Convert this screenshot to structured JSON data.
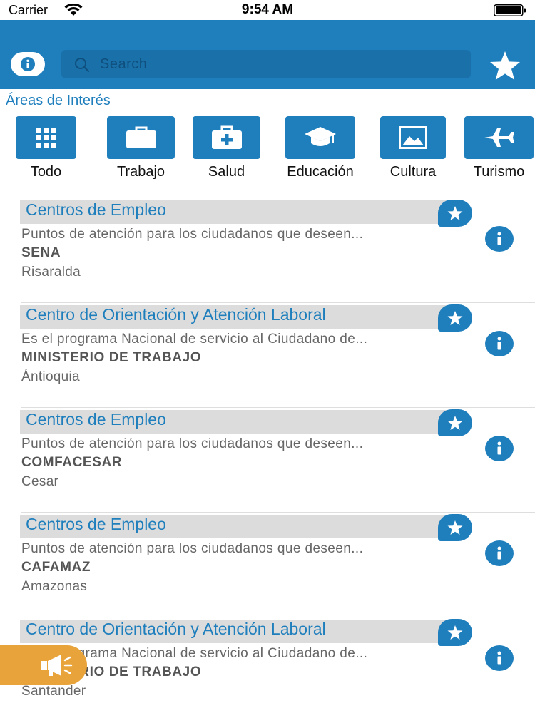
{
  "status_bar": {
    "carrier": "Carrier",
    "time": "9:54 AM"
  },
  "header": {
    "info_icon": "info-icon",
    "search": {
      "placeholder": "Search",
      "icon": "search-icon"
    },
    "favorites_icon": "star-icon"
  },
  "areas": {
    "title": "Áreas de Interés",
    "categories": [
      {
        "label": "Todo",
        "icon": "grid-icon"
      },
      {
        "label": "Trabajo",
        "icon": "briefcase-icon"
      },
      {
        "label": "Salud",
        "icon": "medical-kit-icon"
      },
      {
        "label": "Educación",
        "icon": "graduation-cap-icon"
      },
      {
        "label": "Cultura",
        "icon": "image-icon"
      },
      {
        "label": "Turismo",
        "icon": "airplane-icon"
      }
    ]
  },
  "list": {
    "items": [
      {
        "title": "Centros de Empleo",
        "description": "Puntos de atención para los ciudadanos que deseen...",
        "organization": "SENA",
        "region": "Risaralda"
      },
      {
        "title": "Centro de Orientación y Atención Laboral",
        "description": "Es el programa Nacional de servicio al Ciudadano de...",
        "organization": "MINISTERIO DE TRABAJO",
        "region": "Ántioquia"
      },
      {
        "title": "Centros de Empleo",
        "description": "Puntos de atención para los ciudadanos que deseen...",
        "organization": "COMFACESAR",
        "region": "Cesar"
      },
      {
        "title": "Centros de Empleo",
        "description": "Puntos de atención para los ciudadanos que deseen...",
        "organization": "CAFAMAZ",
        "region": "Amazonas"
      },
      {
        "title": "Centro de Orientación y Atención Laboral",
        "description": "Es el programa Nacional de servicio al Ciudadano de...",
        "organization": "MINISTERIO DE TRABAJO",
        "region": "Santander"
      }
    ]
  },
  "fab": {
    "icon": "megaphone-icon"
  },
  "colors": {
    "primary": "#1f7fbd",
    "title_bar": "#dcdcdc",
    "fab": "#e8a33a"
  }
}
